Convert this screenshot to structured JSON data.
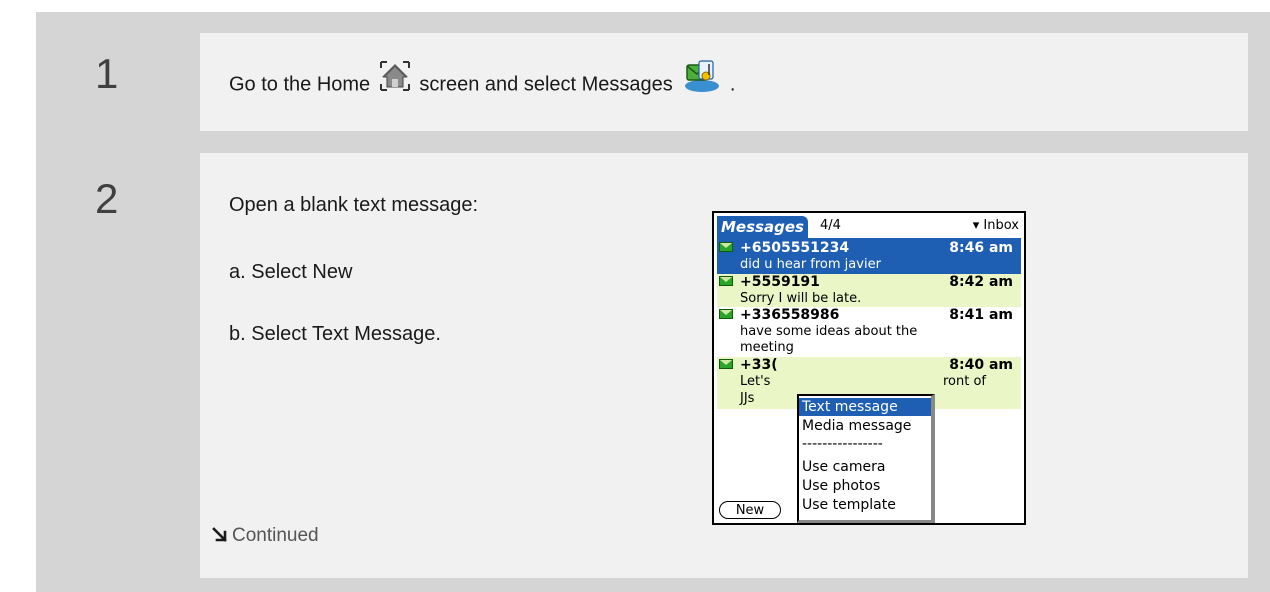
{
  "steps": [
    {
      "number": "1",
      "text_before": "Go to the Home",
      "text_after": "screen and select Messages",
      "text_end": "."
    },
    {
      "number": "2",
      "intro": "Open a blank text message:",
      "sub_a": "a.  Select New",
      "sub_b": "b.  Select Text Message."
    }
  ],
  "continued": "Continued",
  "icons": {
    "home": "home-icon",
    "messages": "messages-app-icon",
    "continued": "continued-arrow-icon"
  },
  "palm": {
    "title": "Messages",
    "count": "4/4",
    "folder": "▾ Inbox",
    "messages": [
      {
        "from": "+6505551234",
        "time": "8:46 am",
        "lines": [
          "did u hear from javier"
        ],
        "selected": true
      },
      {
        "from": "+5559191",
        "time": "8:42 am",
        "lines": [
          "Sorry I will be late."
        ],
        "selected": false
      },
      {
        "from": "+336558986",
        "time": "8:41 am",
        "lines": [
          "have some ideas about the",
          "meeting"
        ],
        "selected": false
      },
      {
        "from": "+33(",
        "time": "8:40 am",
        "lines": [
          "Let's",
          "JJs"
        ],
        "tail": "ront of",
        "selected": false
      }
    ],
    "menu": [
      "Text message",
      "Media message",
      "----------------",
      "Use camera",
      "Use photos",
      "Use template"
    ],
    "new_button": "New"
  },
  "colors": {
    "palm_blue": "#1f5fb3",
    "unread_row": "#eaf6c6",
    "panel_bg": "#f1f1f1",
    "gutter_bg": "#d5d5d5"
  }
}
